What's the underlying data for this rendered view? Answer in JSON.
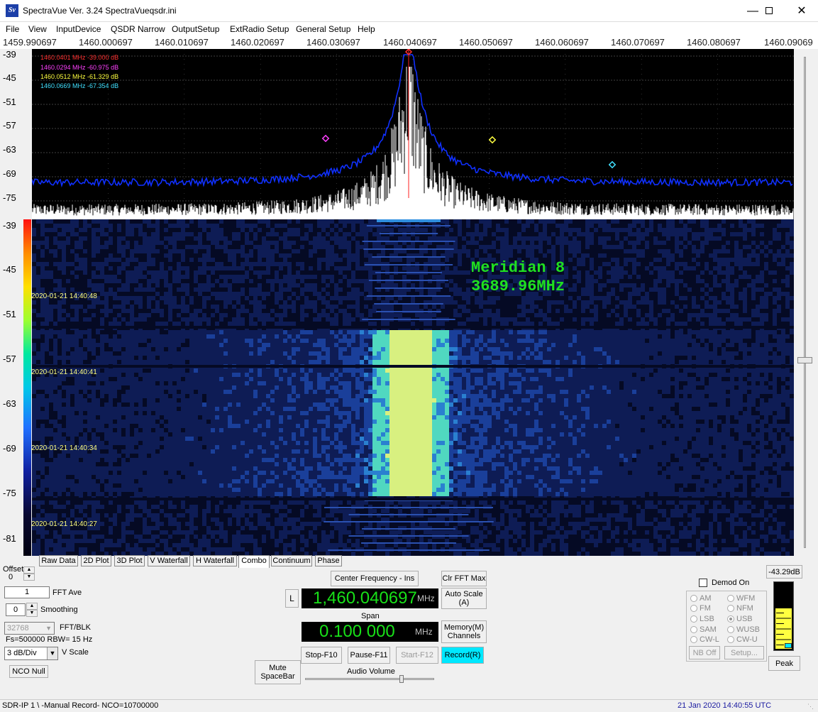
{
  "window": {
    "title": "SpectraVue Ver. 3.24  SpectraVueqsdr.ini",
    "icon_text": "Sv",
    "minimize_icon": "minimize-icon",
    "maximize_icon": "maximize-icon",
    "close_icon": "close-icon"
  },
  "menu": [
    "File",
    "View",
    "InputDevice",
    "QSDR Narrow",
    "OutputSetup",
    "ExtRadio Setup",
    "General Setup",
    "Help"
  ],
  "freq_axis": [
    "1459.990697",
    "1460.000697",
    "1460.010697",
    "1460.020697",
    "1460.030697",
    "1460.040697",
    "1460.050697",
    "1460.060697",
    "1460.070697",
    "1460.080697",
    "1460.09069"
  ],
  "spectrum": {
    "y_labels": [
      "-39",
      "-45",
      "-51",
      "-57",
      "-63",
      "-69",
      "-75"
    ],
    "markers": [
      {
        "text": "1460.0401 MHz  -39.000 dB",
        "color": "#ff3030"
      },
      {
        "text": "1460.0294 MHz  -60.975 dB",
        "color": "#ff40ff"
      },
      {
        "text": "1460.0512 MHz  -61.329 dB",
        "color": "#ffff40"
      },
      {
        "text": "1460.0669 MHz  -67.354 dB",
        "color": "#40e0ff"
      }
    ]
  },
  "waterfall": {
    "y_labels": [
      "-39",
      "-45",
      "-51",
      "-57",
      "-63",
      "-69",
      "-75",
      "-81"
    ],
    "timestamps": [
      "2020-01-21 14:40:48",
      "2020-01-21 14:40:41",
      "2020-01-21 14:40:34",
      "2020-01-21 14:40:27"
    ],
    "overlay_line1": "Meridian 8",
    "overlay_line2": "3689.96MHz"
  },
  "tabs": [
    "Raw Data",
    "2D Plot",
    "3D Plot",
    "V Waterfall",
    "H Waterfall",
    "Combo",
    "Continuum",
    "Phase"
  ],
  "active_tab": "Combo",
  "controls": {
    "offset_label": "Offset",
    "offset_value": "0",
    "fft_ave_value": "1",
    "fft_ave_label": "FFT Ave",
    "smoothing_value": "0",
    "smoothing_label": "Smoothing",
    "fft_blk_value": "32768",
    "fft_blk_label": "FFT/BLK",
    "fs_rbw": "Fs=500000 RBW= 15 Hz",
    "vscale_value": "3 dB/Div",
    "vscale_label": "V Scale",
    "nco_null": "NCO Null",
    "mute": "Mute\nSpaceBar",
    "center_freq_btn": "Center Frequency - Ins",
    "lock_btn": "L",
    "center_freq_value": "1,460.040697",
    "center_freq_unit": "MHz",
    "span_label": "Span",
    "span_value": "0.100 000",
    "span_unit": "MHz",
    "clr_fft_max": "Clr FFT Max",
    "auto_scale": "Auto Scale\n(A)",
    "memory": "Memory(M)\nChannels",
    "stop": "Stop-F10",
    "pause": "Pause-F11",
    "start": "Start-F12",
    "record": "Record(R)",
    "audio_volume": "Audio Volume"
  },
  "demod": {
    "label": "Demod On",
    "modes_left": [
      "AM",
      "FM",
      "LSB",
      "SAM",
      "CW-L"
    ],
    "modes_right": [
      "WFM",
      "NFM",
      "USB",
      "WUSB",
      "CW-U"
    ],
    "selected": "USB",
    "nb_off": "NB Off",
    "setup": "Setup..."
  },
  "meter": {
    "level": "-43.29dB",
    "peak": "Peak",
    "fill_fraction": 0.62
  },
  "status": {
    "left": "SDR-IP 1  \\ -Manual Record-   NCO=10700000",
    "right": "21 Jan 2020  14:40:55 UTC"
  }
}
